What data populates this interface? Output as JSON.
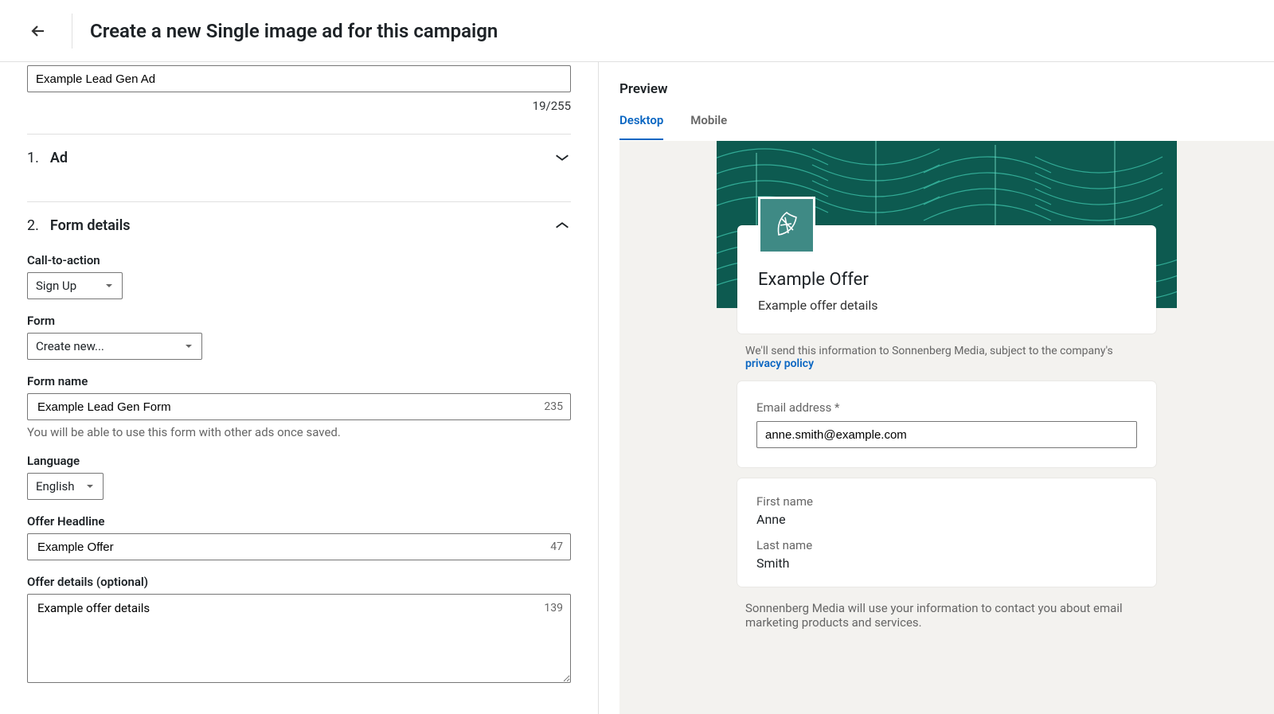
{
  "header": {
    "page_title": "Create a new Single image ad for this campaign"
  },
  "ad_name": {
    "value": "Example Lead Gen Ad",
    "counter": "19/255"
  },
  "sections": {
    "s1": {
      "num": "1.",
      "title": "Ad"
    },
    "s2": {
      "num": "2.",
      "title": "Form details"
    }
  },
  "form": {
    "cta_label": "Call-to-action",
    "cta_value": "Sign Up",
    "form_label": "Form",
    "form_value": "Create new...",
    "form_name_label": "Form name",
    "form_name_value": "Example Lead Gen Form",
    "form_name_counter": "235",
    "form_name_hint": "You will be able to use this form with other ads once saved.",
    "language_label": "Language",
    "language_value": "English",
    "headline_label": "Offer Headline",
    "headline_value": "Example Offer",
    "headline_counter": "47",
    "details_label": "Offer details (optional)",
    "details_value": "Example offer details",
    "details_counter": "139"
  },
  "preview": {
    "title": "Preview",
    "tabs": {
      "desktop": "Desktop",
      "mobile": "Mobile"
    },
    "offer_title": "Example Offer",
    "offer_details": "Example offer details",
    "privacy_prefix": "We'll send this information to Sonnenberg Media, subject to the company's ",
    "privacy_link": "privacy policy",
    "email_label": "Email address *",
    "email_value": "anne.smith@example.com",
    "first_name_label": "First name",
    "first_name_value": "Anne",
    "last_name_label": "Last name",
    "last_name_value": "Smith",
    "usage_text": "Sonnenberg Media will use your information to contact you about email marketing products and services."
  }
}
